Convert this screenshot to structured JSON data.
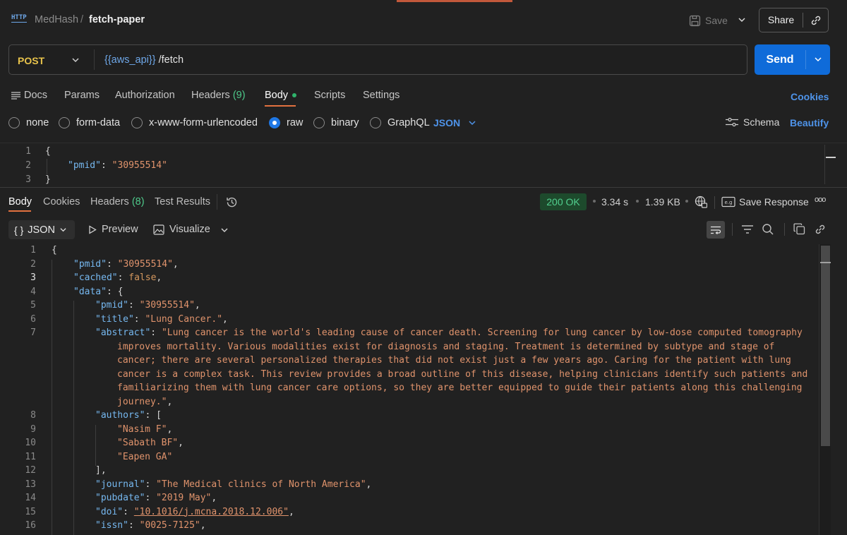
{
  "header": {
    "icon": "http-icon",
    "icon_text": "HTTP",
    "workspace": "MedHash",
    "separator": "/",
    "request_name": "fetch-paper",
    "save_label": "Save",
    "share_label": "Share"
  },
  "request": {
    "method": "POST",
    "url_variable": "{{aws_api}}",
    "url_path": " /fetch",
    "send_label": "Send"
  },
  "request_tabs": {
    "docs": "Docs",
    "params": "Params",
    "authorization": "Authorization",
    "headers": "Headers",
    "headers_count": "(9)",
    "body": "Body",
    "scripts": "Scripts",
    "settings": "Settings",
    "cookies": "Cookies"
  },
  "body_types": {
    "none": "none",
    "form_data": "form-data",
    "urlencoded": "x-www-form-urlencoded",
    "raw": "raw",
    "binary": "binary",
    "graphql": "GraphQL",
    "format": "JSON",
    "schema": "Schema",
    "beautify": "Beautify",
    "selected": "raw"
  },
  "request_body": {
    "lines": [
      {
        "n": "1",
        "text": "{"
      },
      {
        "n": "2",
        "key": "\"pmid\"",
        "sep": ": ",
        "value": "\"30955514\""
      },
      {
        "n": "3",
        "text": "}"
      }
    ]
  },
  "response_tabs": {
    "body": "Body",
    "cookies": "Cookies",
    "headers": "Headers",
    "headers_count": "(8)",
    "test_results": "Test Results"
  },
  "response_meta": {
    "status": "200 OK",
    "time": "3.34 s",
    "size": "1.39 KB",
    "save_response": "Save Response",
    "more": "ooo",
    "status_color": "#52d08f"
  },
  "response_toolbar": {
    "format": "JSON",
    "format_icon": "{ }",
    "preview": "Preview",
    "visualize": "Visualize"
  },
  "response_body": {
    "lines": [
      {
        "n": "1",
        "a": "{"
      },
      {
        "n": "2",
        "k": "\"pmid\"",
        "a": ": ",
        "s": "\"30955514\"",
        "b": ","
      },
      {
        "n": "3",
        "k": "\"cached\"",
        "a": ": ",
        "v": "false",
        "b": ","
      },
      {
        "n": "4",
        "k": "\"data\"",
        "a": ": {"
      },
      {
        "n": "5",
        "k": "\"pmid\"",
        "a": ": ",
        "s": "\"30955514\"",
        "b": ","
      },
      {
        "n": "6",
        "k": "\"title\"",
        "a": ": ",
        "s": "\"Lung Cancer.\"",
        "b": ","
      },
      {
        "n": "7",
        "k": "\"abstract\"",
        "a": ": ",
        "s": "\"Lung cancer is the world's leading cause of cancer death. Screening for lung cancer by low-dose computed tomography"
      },
      {
        "n": "",
        "s": "improves mortality. Various modalities exist for diagnosis and staging. Treatment is determined by subtype and stage of"
      },
      {
        "n": "",
        "s": "cancer; there are several personalized therapies that did not exist just a few years ago. Caring for the patient with lung"
      },
      {
        "n": "",
        "s": "cancer is a complex task. This review provides a broad outline of this disease, helping clinicians identify such patients and"
      },
      {
        "n": "",
        "s": "familiarizing them with lung cancer care options, so they are better equipped to guide their patients along this challenging"
      },
      {
        "n": "",
        "s": "journey.\"",
        "b": ","
      },
      {
        "n": "8",
        "k": "\"authors\"",
        "a": ": ["
      },
      {
        "n": "9",
        "s": "\"Nasim F\"",
        "b": ","
      },
      {
        "n": "10",
        "s": "\"Sabath BF\"",
        "b": ","
      },
      {
        "n": "11",
        "s": "\"Eapen GA\""
      },
      {
        "n": "12",
        "a": "],"
      },
      {
        "n": "13",
        "k": "\"journal\"",
        "a": ": ",
        "s": "\"The Medical clinics of North America\"",
        "b": ","
      },
      {
        "n": "14",
        "k": "\"pubdate\"",
        "a": ": ",
        "s": "\"2019 May\"",
        "b": ","
      },
      {
        "n": "15",
        "k": "\"doi\"",
        "a": ": ",
        "s": "\"10.1016/j.mcna.2018.12.006\"",
        "b": ","
      },
      {
        "n": "16",
        "k": "\"issn\"",
        "a": ": ",
        "s": "\"0025-7125\"",
        "b": ","
      }
    ]
  }
}
